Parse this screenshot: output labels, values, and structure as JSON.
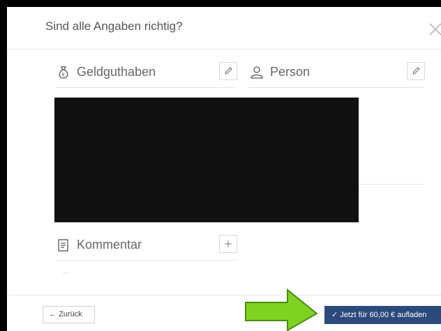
{
  "dialog": {
    "title": "Sind alle Angaben richtig?"
  },
  "sections": {
    "credit": {
      "title": "Geldguthaben"
    },
    "person": {
      "title": "Person"
    },
    "comment": {
      "title": "Kommentar",
      "empty_value": "--"
    }
  },
  "footer": {
    "back_label": "Zurück",
    "confirm_label": "Jetzt für 60,00 € aufladen"
  },
  "icons": {
    "close": "close-icon",
    "credit": "money-bag-icon",
    "person": "person-icon",
    "comment": "document-icon",
    "edit": "pencil-icon",
    "add": "plus-icon",
    "back": "arrow-left-icon",
    "confirm": "checkmark-icon",
    "overlay_arrow": "green-arrow-icon"
  },
  "colors": {
    "primary_button": "#2c4a7c",
    "arrow_green": "#7ed321",
    "redaction": "#111111"
  }
}
